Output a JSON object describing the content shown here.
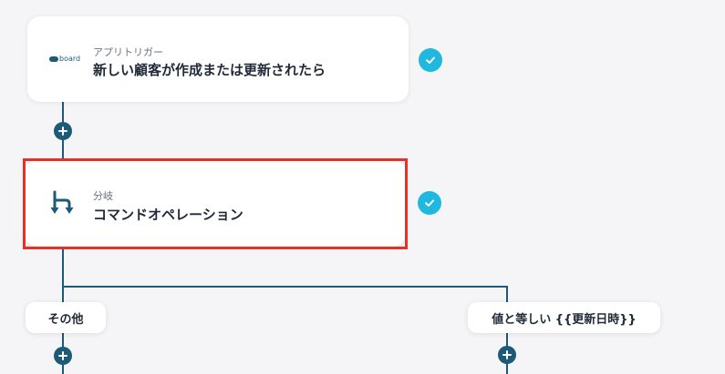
{
  "trigger": {
    "app_logo_text": "board",
    "subtitle": "アプリトリガー",
    "title": "新しい顧客が作成または更新されたら"
  },
  "branch_step": {
    "subtitle": "分岐",
    "title": "コマンドオペレーション"
  },
  "branches": [
    {
      "label": "その他"
    },
    {
      "label": "値と等しい {{更新日時}}"
    }
  ],
  "colors": {
    "connector": "#1d5a78",
    "check": "#21b8e0",
    "highlight": "#e63127"
  }
}
